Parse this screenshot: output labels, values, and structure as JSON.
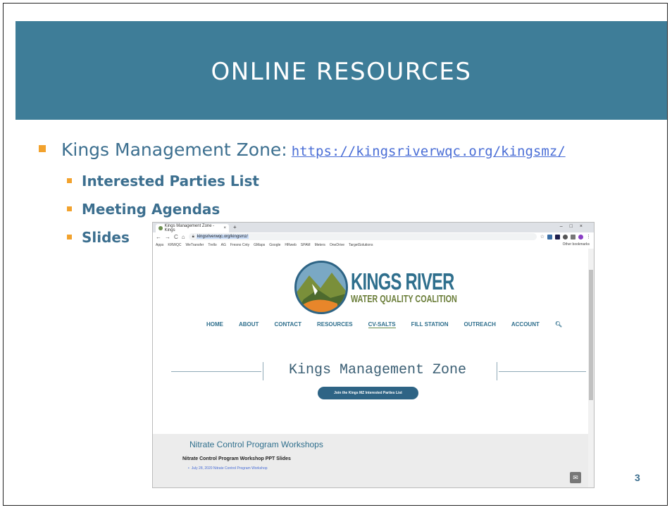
{
  "slide": {
    "title": "ONLINE RESOURCES",
    "main_bullet": "Kings Management Zone:",
    "main_link": "https://kingsriverwqc.org/kingsmz/",
    "sub_bullets": [
      "Interested Parties List",
      "Meeting Agendas",
      "Slides"
    ],
    "page_number": "3"
  },
  "browser": {
    "tab_title": "Kings Management Zone - Kings",
    "tab_close": "×",
    "new_tab": "+",
    "window_controls": "–□×",
    "url": "kingsriverwqc.org/kingsmz/",
    "bookmarks": [
      "Apps",
      "KRWQC",
      "WeTransfer",
      "Trello",
      "AG",
      "Fresno Cnty",
      "GMaps",
      "Google",
      "HRweb",
      "SPAM",
      "Meters",
      "OneDrive",
      "TargetSolutions"
    ],
    "other_bookmarks": "Other bookmarks"
  },
  "site": {
    "logo_line1": "KINGS RIVER",
    "logo_line2": "WATER QUALITY COALITION",
    "nav": [
      "HOME",
      "ABOUT",
      "CONTACT",
      "RESOURCES",
      "CV-SALTS",
      "FILL STATION",
      "OUTREACH",
      "ACCOUNT"
    ],
    "search_icon": "search-icon",
    "page_heading": "Kings Management Zone",
    "join_button": "Join the Kings MZ Interested Parties List",
    "section_title": "Nitrate Control Program Workshops",
    "section_subtitle": "Nitrate Control Program Workshop PPT Slides",
    "section_link": "July 28, 2020 Nitrate Control Program Workshop"
  },
  "colors": {
    "title_band": "#3e7d98",
    "bullet_square": "#f2a22d",
    "bullet_text": "#3c6f8f",
    "link": "#4a6ed6"
  }
}
